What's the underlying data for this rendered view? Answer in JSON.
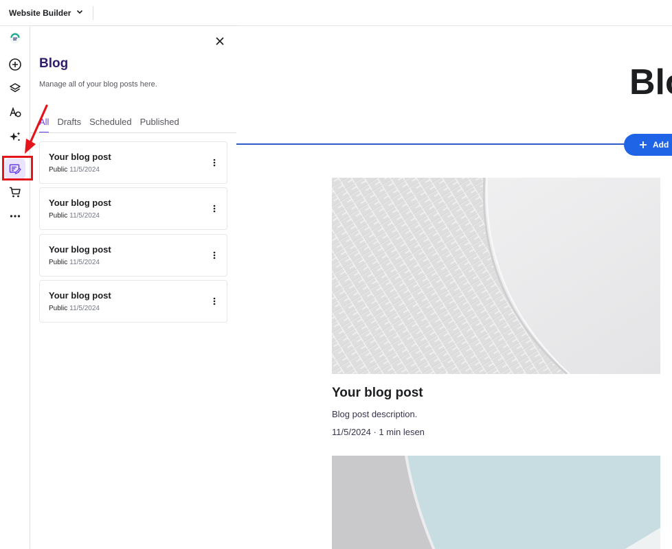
{
  "topbar": {
    "app_title": "Website Builder"
  },
  "rail": {
    "items": [
      {
        "icon": "logo-icon"
      },
      {
        "icon": "add-element-icon"
      },
      {
        "icon": "layers-icon"
      },
      {
        "icon": "styles-icon"
      },
      {
        "icon": "ai-tools-icon"
      },
      {
        "icon": "blog-icon"
      },
      {
        "icon": "store-icon"
      },
      {
        "icon": "more-icon"
      }
    ]
  },
  "panel": {
    "title": "Blog",
    "subtitle": "Manage all of your blog posts here.",
    "tabs": [
      {
        "label": "All",
        "active": true
      },
      {
        "label": "Drafts",
        "active": false
      },
      {
        "label": "Scheduled",
        "active": false
      },
      {
        "label": "Published",
        "active": false
      }
    ],
    "posts": [
      {
        "title": "Your blog post",
        "status": "Public",
        "date": "11/5/2024"
      },
      {
        "title": "Your blog post",
        "status": "Public",
        "date": "11/5/2024"
      },
      {
        "title": "Your blog post",
        "status": "Public",
        "date": "11/5/2024"
      },
      {
        "title": "Your blog post",
        "status": "Public",
        "date": "11/5/2024"
      }
    ]
  },
  "canvas": {
    "heading": "Blo",
    "add_label": "Add",
    "article": {
      "title": "Your blog post",
      "description": "Blog post description.",
      "meta": "11/5/2024 · 1 min lesen"
    }
  },
  "colors": {
    "accent": "#673de6",
    "highlight": "#e5141b",
    "button": "#1f63e6",
    "section_line": "#2d5bc9"
  }
}
